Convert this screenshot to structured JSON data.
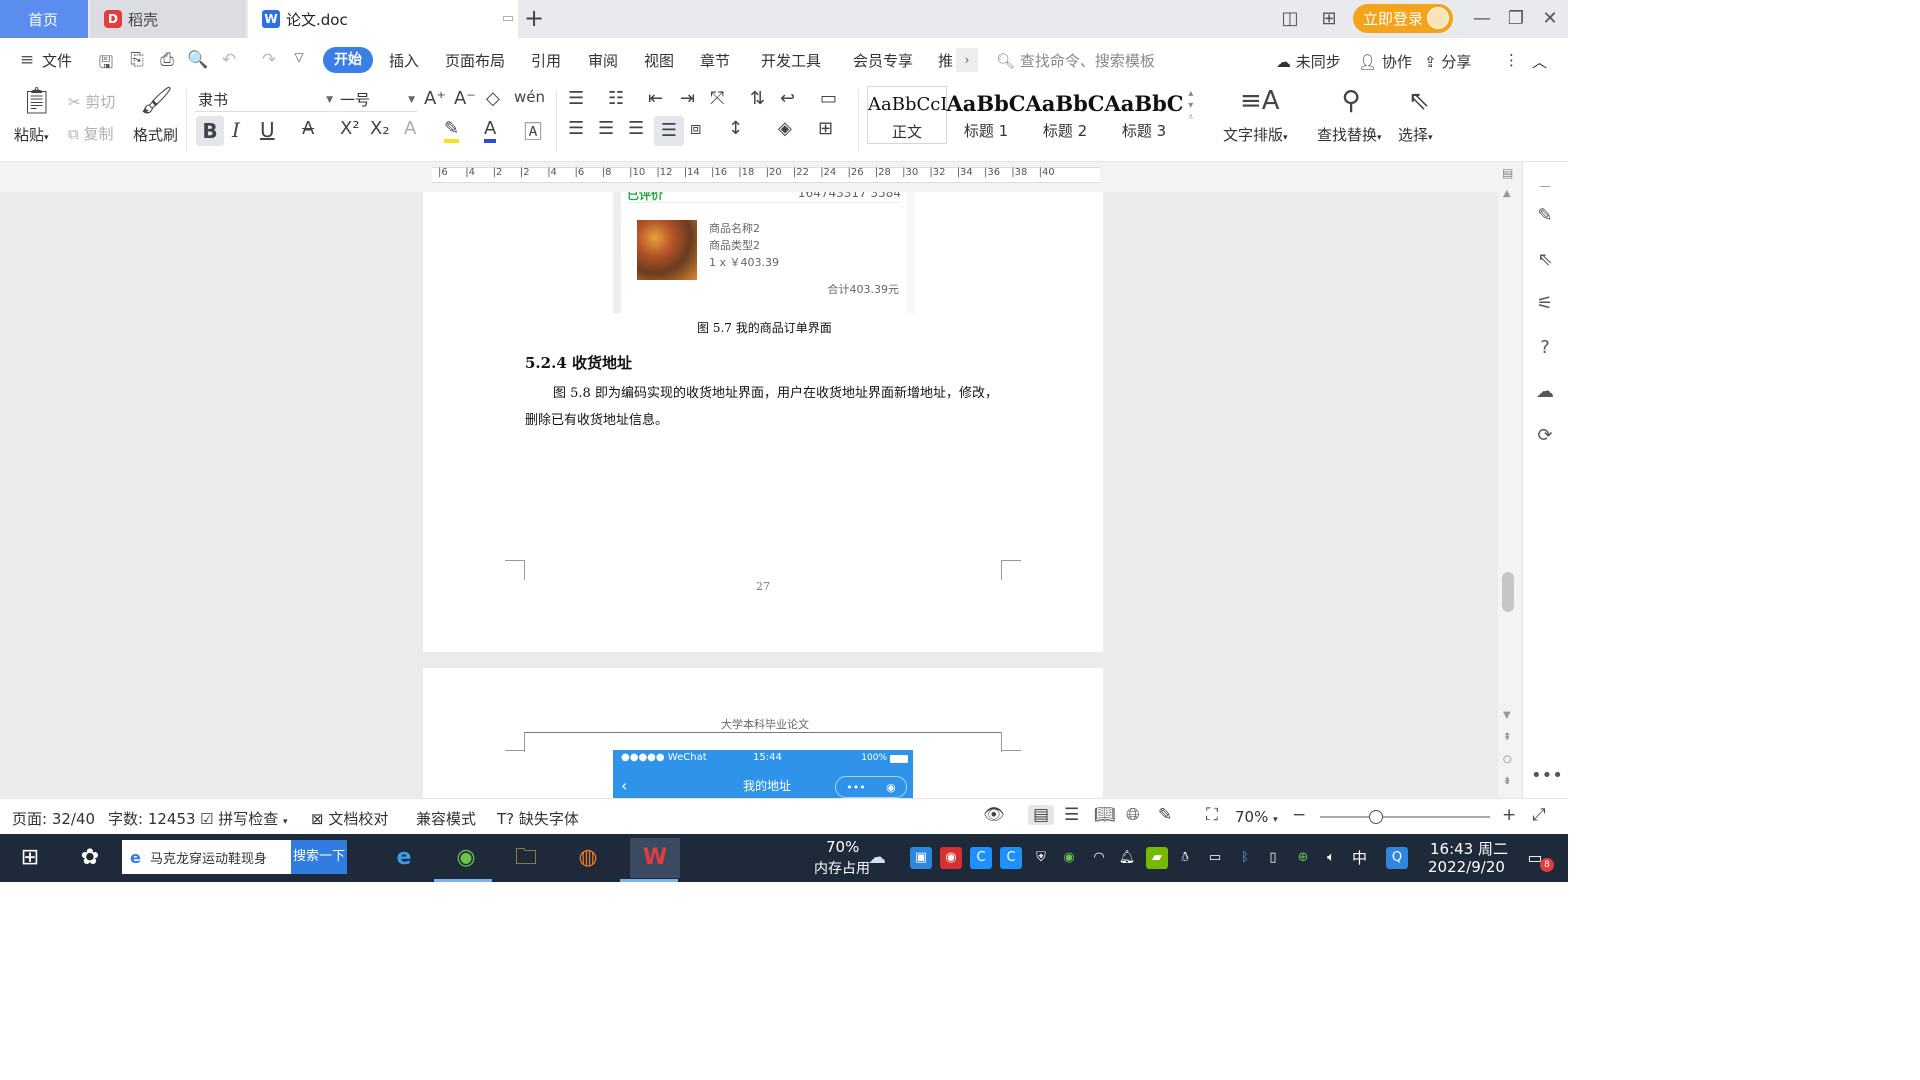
{
  "tabs": {
    "home": "首页",
    "daoke": "稻壳",
    "doc": "论文.doc",
    "new_tab": "+"
  },
  "titlebar": {
    "login": "立即登录"
  },
  "menu": {
    "file": "文件",
    "items": [
      "开始",
      "插入",
      "页面布局",
      "引用",
      "审阅",
      "视图",
      "章节",
      "开发工具",
      "会员专享",
      "推"
    ],
    "search_placeholder": "查找命令、搜索模板",
    "sync": "未同步",
    "collab": "协作",
    "share": "分享"
  },
  "ribbon": {
    "paste": "粘贴",
    "cut": "剪切",
    "copy": "复制",
    "format_painter": "格式刷",
    "font_name": "隶书",
    "font_size": "一号",
    "styles": [
      {
        "sample": "AaBbCcI",
        "label": "正文"
      },
      {
        "sample": "AaBbC",
        "label": "标题 1"
      },
      {
        "sample": "AaBbC",
        "label": "标题 2"
      },
      {
        "sample": "AaBbC",
        "label": "标题 3"
      }
    ],
    "text_layout": "文字排版",
    "find_replace": "查找替换",
    "select": "选择"
  },
  "ruler_ticks": [
    "6",
    "4",
    "2",
    "2",
    "4",
    "6",
    "8",
    "10",
    "12",
    "14",
    "16",
    "18",
    "20",
    "22",
    "24",
    "26",
    "28",
    "30",
    "32",
    "34",
    "36",
    "38",
    "40"
  ],
  "document": {
    "shot_status": "已评价",
    "shot_order": "164743317 3584",
    "product_name": "商品名称2",
    "product_type": "商品类型2",
    "product_qty_price": "1 x ￥403.39",
    "product_total": "合计403.39元",
    "caption": "图 5.7  我的商品订单界面",
    "heading": "5.2.4  收货地址",
    "para_line1": "图 5.8  即为编码实现的收货地址界面，用户在收货地址界面新增地址，修改，",
    "para_line2": "删除已有收货地址信息。",
    "page_number": "27",
    "page2_header": "大学本科毕业论文",
    "wechat_carrier": "●●●●● WeChat",
    "wechat_time": "15:44",
    "wechat_battery": "100%",
    "wechat_title": "我的地址"
  },
  "statusbar": {
    "page": "页面: 32/40",
    "words": "字数: 12453",
    "spell": "拼写检查",
    "proof": "文档校对",
    "compat": "兼容模式",
    "missing_font": "缺失字体",
    "zoom": "70%",
    "zoom_level": 0.33
  },
  "taskbar": {
    "search_text": "马克龙穿运动鞋现身",
    "search_button": "搜索一下",
    "memory_pct": "70%",
    "memory_label": "内存占用",
    "ime": "中",
    "time": "16:43 周二",
    "date": "2022/9/20",
    "notif_count": "8"
  }
}
